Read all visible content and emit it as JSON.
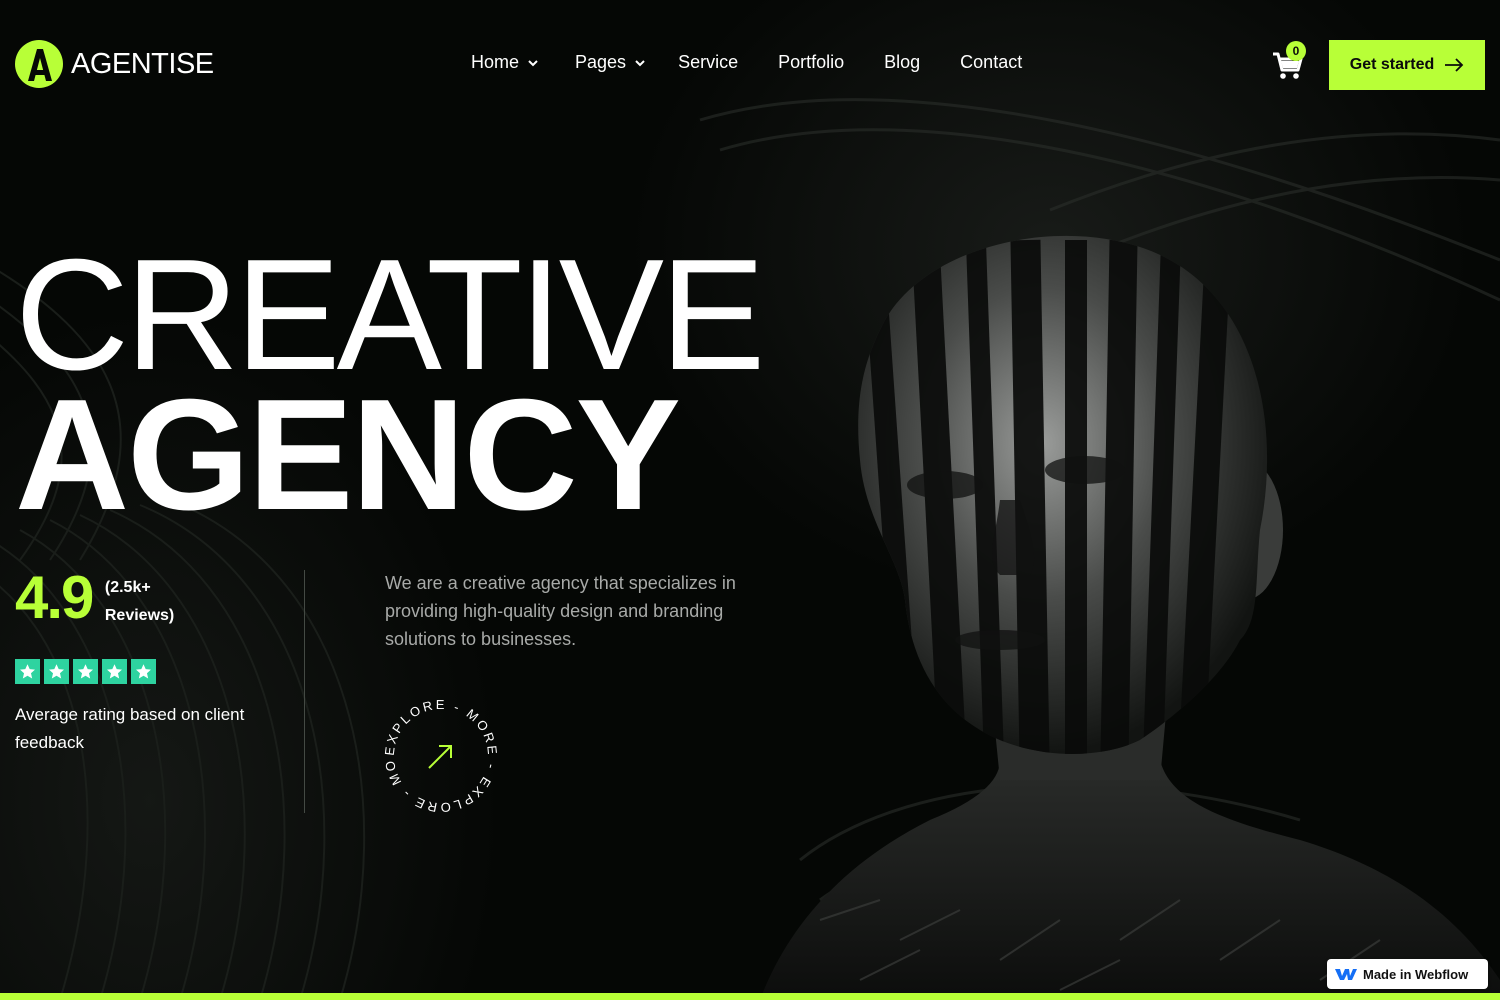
{
  "brand": {
    "name": "AGENTISE",
    "accent": "#b8ff37"
  },
  "nav": {
    "items": [
      {
        "label": "Home",
        "dropdown": true
      },
      {
        "label": "Pages",
        "dropdown": true
      },
      {
        "label": "Service",
        "dropdown": false
      },
      {
        "label": "Portfolio",
        "dropdown": false
      },
      {
        "label": "Blog",
        "dropdown": false
      },
      {
        "label": "Contact",
        "dropdown": false
      }
    ]
  },
  "cart": {
    "count": "0",
    "icon": "cart-icon"
  },
  "cta": {
    "label": "Get started",
    "icon": "arrow-right-icon"
  },
  "hero": {
    "line1": "CREATIVE",
    "line2": "AGENCY"
  },
  "rating": {
    "value": "4.9",
    "count": "(2.5k+ Reviews)",
    "stars": 5,
    "star_color": "#2ed3a0",
    "description": "Average rating based on client feedback"
  },
  "intro": {
    "text": "We are a creative agency that specializes in providing high-quality design and branding solutions to businesses."
  },
  "explore": {
    "ring_text": "EXPLORE - MORE - EXPLORE - MORE -",
    "icon": "arrow-up-right-icon"
  },
  "badge": {
    "label": "Made in Webflow",
    "icon": "webflow-icon"
  }
}
